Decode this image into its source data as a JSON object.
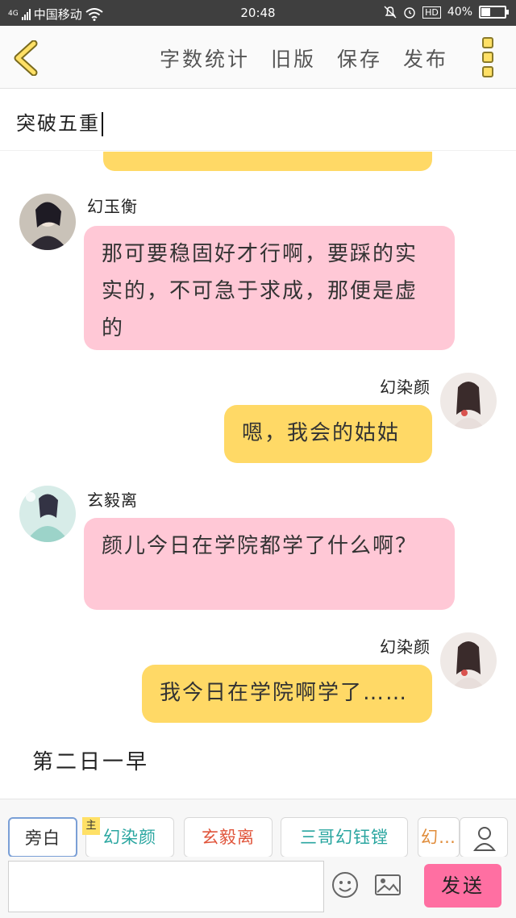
{
  "status_bar": {
    "network": "4G",
    "carrier": "中国移动",
    "time": "20:48",
    "hd": "HD",
    "battery": "40%",
    "battery_level": 0.4
  },
  "toolbar": {
    "items": [
      "字数统计",
      "旧版",
      "保存",
      "发布"
    ]
  },
  "title": "突破五重",
  "messages": [
    {
      "side": "left",
      "name": "幻玉衡",
      "text": "那可要稳固好才行啊，要踩的实实的，不可急于求成，那便是虚的"
    },
    {
      "side": "right",
      "name": "幻染颜",
      "text": "嗯，我会的姑姑"
    },
    {
      "side": "left",
      "name": "玄毅离",
      "text": "颜儿今日在学院都学了什么啊？"
    },
    {
      "side": "right",
      "name": "幻染颜",
      "text": "我今日在学院啊学了……"
    }
  ],
  "narration": "第二日一早",
  "roles": {
    "badge": "主",
    "items": [
      {
        "label": "旁白",
        "color": "#333333"
      },
      {
        "label": "幻染颜",
        "color": "#2aa6a0"
      },
      {
        "label": "玄毅离",
        "color": "#e0543a"
      },
      {
        "label": "三哥幻钰镗",
        "color": "#2aa6a0"
      },
      {
        "label": "幻…",
        "color": "#e08c3a"
      }
    ]
  },
  "input": {
    "placeholder": "",
    "send_label": "发送"
  },
  "icons": {
    "back": "chevron-left-icon",
    "more": "more-vertical-icon",
    "user": "user-icon",
    "emoji": "smiley-icon",
    "image": "image-icon",
    "wifi": "wifi-icon",
    "mute": "bell-off-icon",
    "alarm": "alarm-icon"
  },
  "colors": {
    "accent_yellow": "#ffd966",
    "pink_bubble": "#ffc8d6",
    "send_button": "#ff6fa2",
    "status_bar": "#3f3f3f"
  }
}
